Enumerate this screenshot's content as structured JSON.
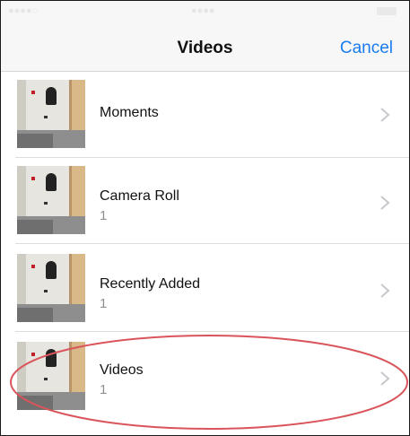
{
  "navbar": {
    "title": "Videos",
    "cancel_label": "Cancel"
  },
  "albums": [
    {
      "title": "Moments",
      "count": ""
    },
    {
      "title": "Camera Roll",
      "count": "1"
    },
    {
      "title": "Recently Added",
      "count": "1"
    },
    {
      "title": "Videos",
      "count": "1"
    }
  ],
  "colors": {
    "accent": "#1a7cf2",
    "highlight_ring": "#d9555b"
  },
  "icons": {
    "row_disclosure": "chevron-right-icon",
    "status_battery": "battery-icon"
  }
}
